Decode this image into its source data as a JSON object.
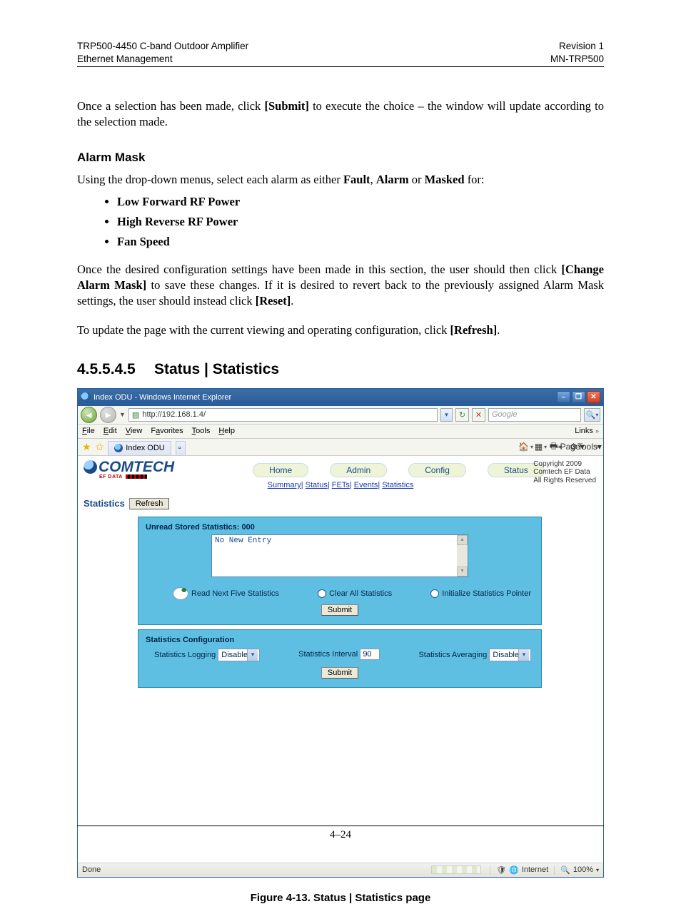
{
  "header": {
    "left1": "TRP500-4450 C-band Outdoor Amplifier",
    "left2": "Ethernet Management",
    "right1": "Revision 1",
    "right2": "MN-TRP500"
  },
  "para1a": "Once a selection has been made, click ",
  "para1b": "[Submit]",
  "para1c": " to execute the choice – the window will update according to the selection made.",
  "h_alarm": "Alarm Mask",
  "para2a": "Using the drop-down menus, select each alarm as either ",
  "para2b": "Fault",
  "para2c": ", ",
  "para2d": "Alarm",
  "para2e": " or ",
  "para2f": "Masked",
  "para2g": " for:",
  "bullets": {
    "b1": "Low Forward RF Power",
    "b2": "High Reverse RF Power",
    "b3": "Fan Speed"
  },
  "para3a": "Once the desired configuration settings have been made in this section, the user should then click ",
  "para3b": "[Change Alarm Mask]",
  "para3c": " to save these changes. If it is desired to revert back to the previously assigned Alarm Mask settings, the user should instead click ",
  "para3d": "[Reset]",
  "para3e": ".",
  "para4a": "To update the page with the current viewing and operating configuration, click ",
  "para4b": "[Refresh]",
  "para4c": ".",
  "sec": {
    "num": "4.5.5.4.5",
    "title": "Status | Statistics"
  },
  "ie": {
    "title": "Index ODU - Windows Internet Explorer",
    "url": "http://192.168.1.4/",
    "search_placeholder": "Google",
    "menus": {
      "file": "File",
      "edit": "Edit",
      "view": "View",
      "fav": "Favorites",
      "tools": "Tools",
      "help": "Help"
    },
    "links": "Links",
    "tab": "Index ODU",
    "toolbar": {
      "page": "Page",
      "tools": "Tools"
    },
    "brand": "COMTECH",
    "brand_sub": "EF DATA",
    "nav": {
      "home": "Home",
      "admin": "Admin",
      "config": "Config",
      "status": "Status"
    },
    "copyright1": "Copyright 2009",
    "copyright2": "Comtech EF Data",
    "copyright3": "All Rights Reserved",
    "subnav": {
      "summary": "Summary",
      "status": "Status",
      "fets": "FETs",
      "events": "Events",
      "stats": "Statistics"
    },
    "stats_head": "Statistics",
    "refresh": "Refresh",
    "panel1_hdr": "Unread Stored Statistics: 000",
    "no_entry": "No New Entry",
    "radios": {
      "r1": "Read Next Five Statistics",
      "r2": "Clear All Statistics",
      "r3": "Initialize Statistics Pointer"
    },
    "submit": "Submit",
    "panel2_hdr": "Statistics Configuration",
    "cfg": {
      "logging_lbl": "Statistics Logging",
      "logging_val": "Disable",
      "interval_lbl": "Statistics Interval",
      "interval_val": "90",
      "avg_lbl": "Statistics Averaging",
      "avg_val": "Disable"
    },
    "status_done": "Done",
    "status_zone": "Internet",
    "status_zoom": "100%"
  },
  "fig_caption": "Figure 4-13. Status | Statistics page",
  "page_num": "4–24"
}
